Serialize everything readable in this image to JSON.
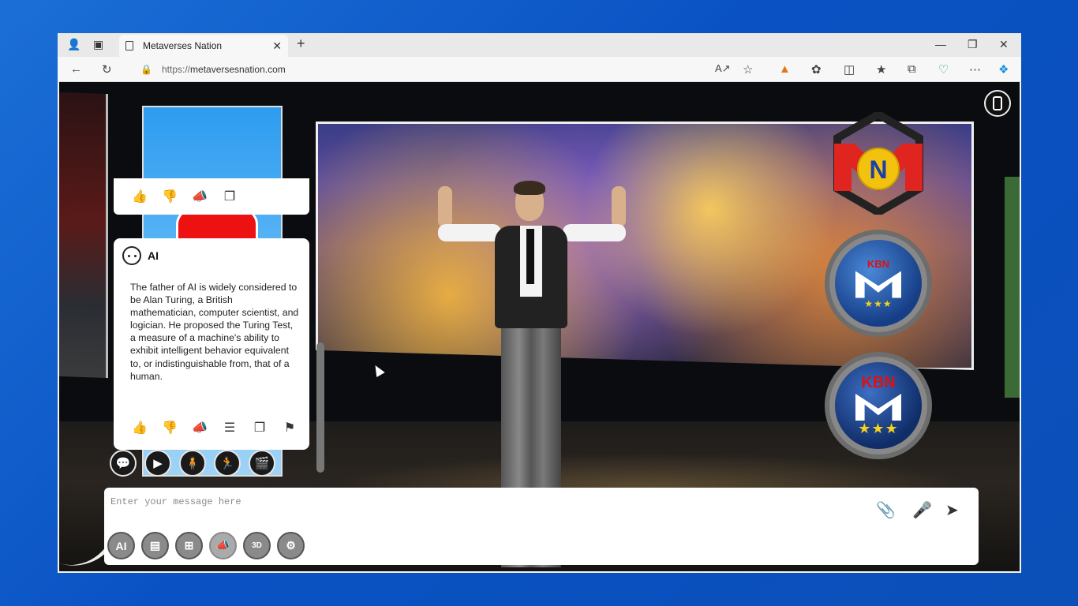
{
  "browser": {
    "tab_title": "Metaverses Nation",
    "url_scheme": "https://",
    "url_host": "metaversesnation.com",
    "icons": [
      "profile-icon",
      "tab-actions-icon",
      "page-icon",
      "close-tab-icon",
      "new-tab-icon",
      "minimize-icon",
      "restore-icon",
      "close-window-icon",
      "back-icon",
      "refresh-icon",
      "lock-icon",
      "read-aloud-icon",
      "favorite-icon",
      "metamask-icon",
      "extensions-icon",
      "split-screen-icon",
      "favorites-icon",
      "collections-icon",
      "health-icon",
      "more-icon",
      "copilot-icon"
    ]
  },
  "ai_card": {
    "name": "AI",
    "message": "The father of AI is widely considered to be Alan Turing, a British mathematician, computer scientist, and logician. He proposed the Turing Test, a measure of a machine's ability to exhibit intelligent behavior equivalent to, or indistinguishable from, that of a human."
  },
  "badges": {
    "kbn_small": "KBN",
    "kbn_large": "KBN",
    "logo_letter": "N"
  },
  "chat": {
    "placeholder": "Enter your message here",
    "ai_button": "AI",
    "tool_3d": "3D"
  },
  "colors": {
    "desktop_blue": "#0a52c4",
    "brand_red": "#d11",
    "star_yellow": "#f5d31a"
  }
}
